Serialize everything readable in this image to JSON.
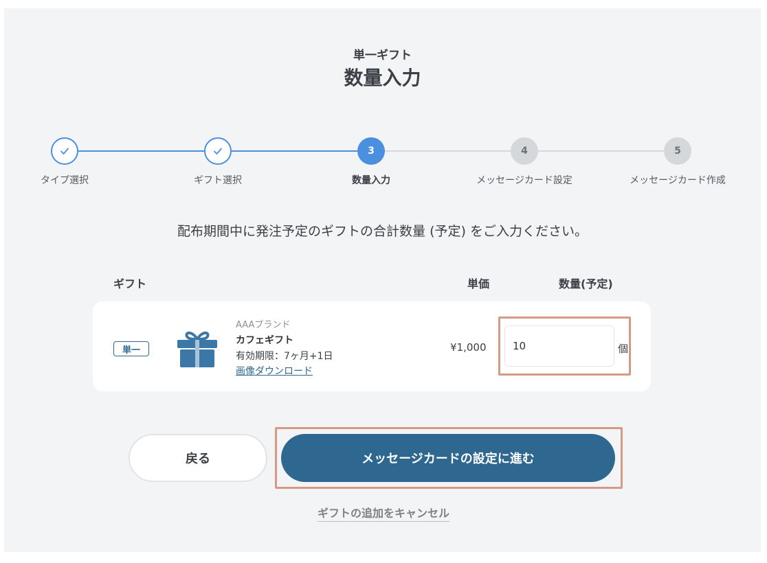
{
  "header": {
    "subtitle": "単一ギフト",
    "title": "数量入力"
  },
  "stepper": {
    "steps": [
      {
        "number": "",
        "label": "タイプ選択",
        "state": "done"
      },
      {
        "number": "",
        "label": "ギフト選択",
        "state": "done"
      },
      {
        "number": "3",
        "label": "数量入力",
        "state": "active"
      },
      {
        "number": "4",
        "label": "メッセージカード設定",
        "state": "todo"
      },
      {
        "number": "5",
        "label": "メッセージカード作成",
        "state": "todo"
      }
    ],
    "check_icon": "check-icon"
  },
  "instruction": "配布期間中に発注予定のギフトの合計数量 (予定) をご入力ください。",
  "table": {
    "headers": {
      "gift": "ギフト",
      "unit_price": "単価",
      "quantity": "数量(予定)"
    },
    "rows": [
      {
        "badge": "単一",
        "icon": "gift-icon",
        "brand": "AAAブランド",
        "name": "カフェギフト",
        "validity": "有効期限：7ヶ月+1日",
        "download_label": "画像ダウンロード",
        "price": "¥1,000",
        "quantity_value": "10",
        "quantity_unit": "個"
      }
    ]
  },
  "actions": {
    "back_label": "戻る",
    "next_label": "メッセージカードの設定に進む",
    "cancel_label": "ギフトの追加をキャンセル"
  },
  "colors": {
    "accent": "#4a8fe0",
    "primary_button": "#2e6890",
    "highlight": "#d59a85",
    "panel_background": "#f3f4f5"
  }
}
